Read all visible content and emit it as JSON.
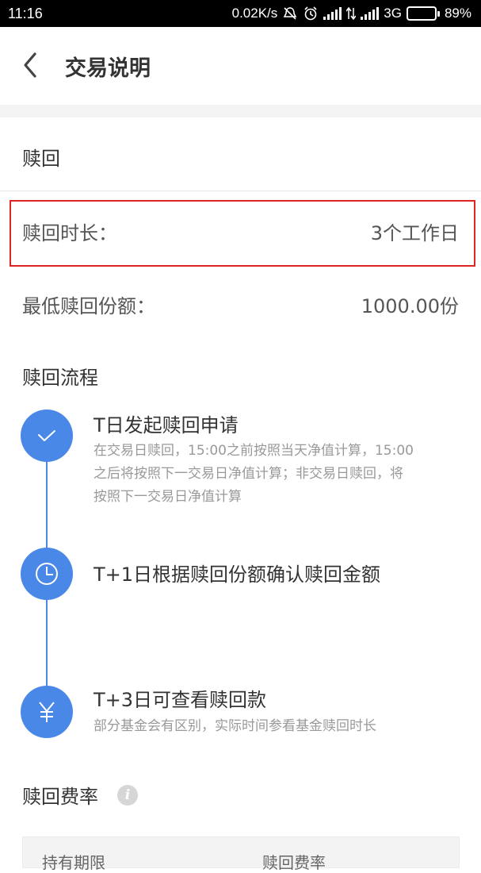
{
  "status_bar": {
    "time": "11:16",
    "speed": "0.02K/s",
    "network": "3G",
    "battery": "89%",
    "battery_level": 0.89
  },
  "header": {
    "title": "交易说明"
  },
  "redeem": {
    "section_title": "赎回",
    "duration_label": "赎回时长：",
    "duration_value": "3个工作日",
    "min_label": "最低赎回份额：",
    "min_value": "1000.00份"
  },
  "process": {
    "title": "赎回流程",
    "steps": [
      {
        "icon": "check-icon",
        "title": "T日发起赎回申请",
        "desc_lines": [
          "在交易日赎回，15:00之前按照当天净值计算，15:00",
          "之后将按照下一交易日净值计算；非交易日赎回，将",
          "按照下一交易日净值计算"
        ]
      },
      {
        "icon": "clock-icon",
        "title": "T+1日根据赎回份额确认赎回金额"
      },
      {
        "icon": "yen-icon",
        "title": "T+3日可查看赎回款",
        "desc": "部分基金会有区别，实际时间参看基金赎回时长"
      }
    ]
  },
  "fee": {
    "title": "赎回费率",
    "info_glyph": "i",
    "columns": [
      "持有期限",
      "赎回费率"
    ]
  },
  "colors": {
    "accent": "#4a88e8",
    "highlight": "#e02424"
  }
}
